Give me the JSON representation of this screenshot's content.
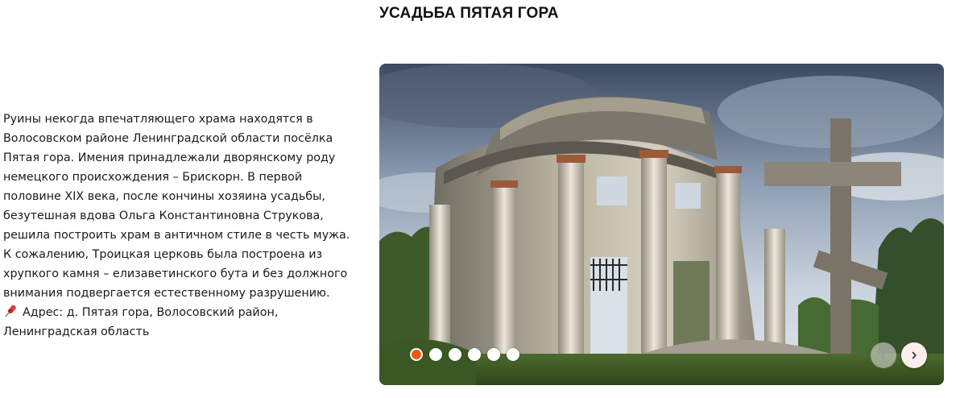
{
  "header": {
    "title": "УСАДЬБА ПЯТАЯ ГОРА"
  },
  "description": {
    "text": "Руины некогда впечатляющего храма находятся в Волосовском районе Ленинградской области посёлка Пятая гора. Имения принадлежали дворянскому роду немецкого происхождения – Брискорн. В первой половине XIX века, после кончины хозяина усадьбы, безутешная вдова Ольга Константиновна Струкова, решила построить храм в античном стиле в честь мужа. К сожалению, Троицкая церковь была построена из хрупкого камня – елизаветинского бута и без должного внимания подвергается естественному разрушению.",
    "address_icon": "pushpin-icon",
    "address": "Адрес: д. Пятая гора, Волосовский район, Ленинградская область"
  },
  "slider": {
    "slide_count": 6,
    "active_index": 0,
    "colors": {
      "active_dot": "#ea5b0c",
      "inactive_dot": "#ffffff"
    },
    "prev_icon": "chevron-left-icon",
    "next_icon": "chevron-right-icon"
  }
}
